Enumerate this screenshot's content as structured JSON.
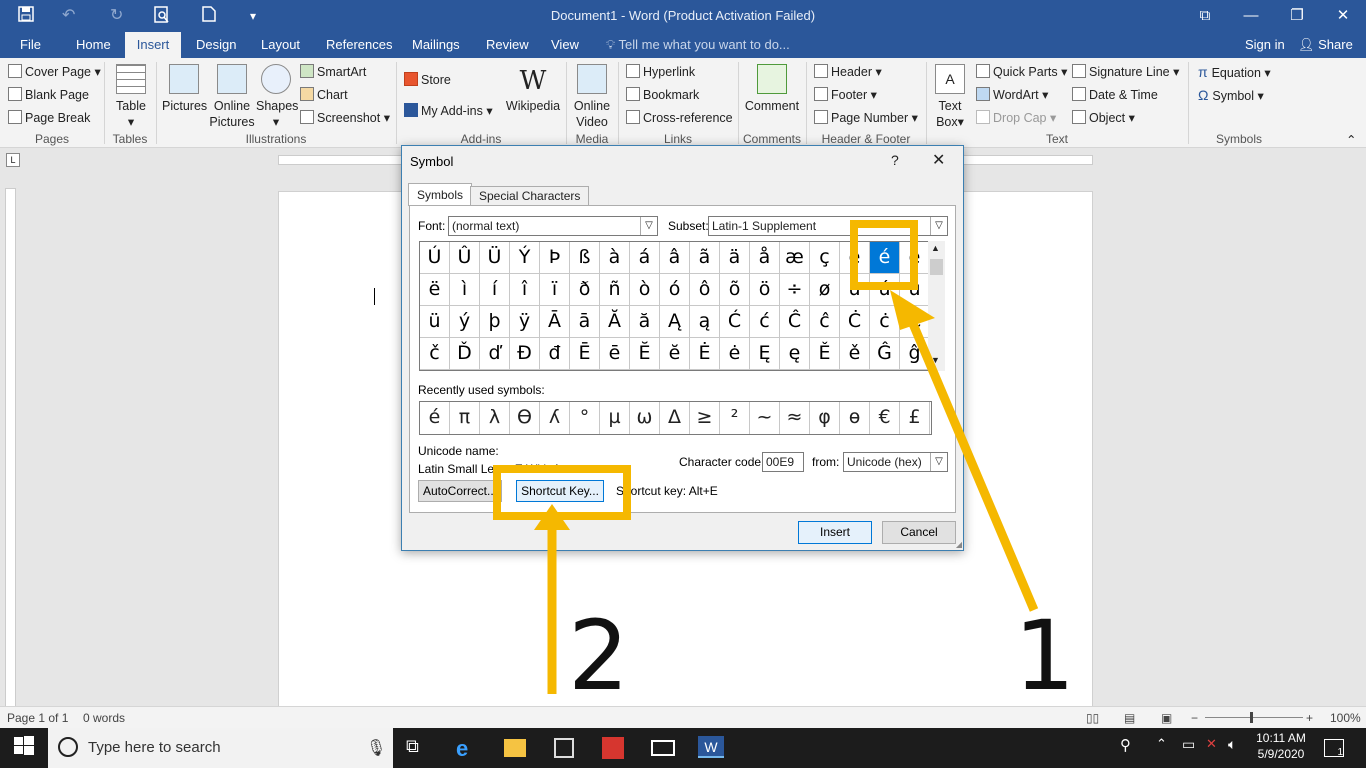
{
  "window": {
    "title": "Document1 - Word (Product Activation Failed)"
  },
  "tabs": [
    {
      "label": "File"
    },
    {
      "label": "Home"
    },
    {
      "label": "Insert"
    },
    {
      "label": "Design"
    },
    {
      "label": "Layout"
    },
    {
      "label": "References"
    },
    {
      "label": "Mailings"
    },
    {
      "label": "Review"
    },
    {
      "label": "View"
    }
  ],
  "tellme": "Tell me what you want to do...",
  "account": {
    "signin": "Sign in",
    "share": "Share"
  },
  "ribbon": {
    "pages": {
      "cover": "Cover Page",
      "blank": "Blank Page",
      "break": "Page Break",
      "group": "Pages"
    },
    "tables": {
      "table": "Table",
      "group": "Tables"
    },
    "illustrations": {
      "pictures": "Pictures",
      "online": "Online",
      "online2": "Pictures",
      "shapes": "Shapes",
      "smartart": "SmartArt",
      "chart": "Chart",
      "screenshot": "Screenshot",
      "group": "Illustrations"
    },
    "addins": {
      "store": "Store",
      "myaddins": "My Add-ins",
      "wikipedia": "Wikipedia",
      "group": "Add-ins"
    },
    "media": {
      "online": "Online",
      "video": "Video",
      "group": "Media"
    },
    "links": {
      "hyperlink": "Hyperlink",
      "bookmark": "Bookmark",
      "crossref": "Cross-reference",
      "group": "Links"
    },
    "comments": {
      "comment": "Comment",
      "group": "Comments"
    },
    "headerfooter": {
      "header": "Header",
      "footer": "Footer",
      "pagenumber": "Page Number",
      "group": "Header & Footer"
    },
    "text": {
      "textbox": "Text",
      "textbox2": "Box",
      "quickparts": "Quick Parts",
      "wordart": "WordArt",
      "dropcap": "Drop Cap",
      "sigline": "Signature Line",
      "datetime": "Date & Time",
      "object": "Object",
      "group": "Text"
    },
    "symbols": {
      "equation": "Equation",
      "symbol": "Symbol",
      "group": "Symbols"
    }
  },
  "dialog": {
    "title": "Symbol",
    "help": "?",
    "tab_symbols": "Symbols",
    "tab_special": "Special Characters",
    "font_label": "Font:",
    "font_value": "(normal text)",
    "subset_label": "Subset:",
    "subset_value": "Latin-1 Supplement",
    "grid": [
      [
        "Ú",
        "Û",
        "Ü",
        "Ý",
        "Þ",
        "ß",
        "à",
        "á",
        "â",
        "ã",
        "ä",
        "å",
        "æ",
        "ç",
        "è",
        "é",
        "ê"
      ],
      [
        "ë",
        "ì",
        "í",
        "î",
        "ï",
        "ð",
        "ñ",
        "ò",
        "ó",
        "ô",
        "õ",
        "ö",
        "÷",
        "ø",
        "ù",
        "ú",
        "û"
      ],
      [
        "ü",
        "ý",
        "þ",
        "ÿ",
        "Ā",
        "ā",
        "Ă",
        "ă",
        "Ą",
        "ą",
        "Ć",
        "ć",
        "Ĉ",
        "ĉ",
        "Ċ",
        "ċ",
        "Č"
      ],
      [
        "č",
        "Ď",
        "ď",
        "Đ",
        "đ",
        "Ē",
        "ē",
        "Ĕ",
        "ĕ",
        "Ė",
        "ė",
        "Ę",
        "ę",
        "Ě",
        "ě",
        "Ĝ",
        "ĝ"
      ]
    ],
    "recent_label": "Recently used symbols:",
    "recent": [
      "é",
      "π",
      "λ",
      "ϴ",
      "ʎ",
      "°",
      "µ",
      "ω",
      "Δ",
      "≥",
      "²",
      "~",
      "≈",
      "φ",
      "ө",
      "€",
      "£"
    ],
    "unicode_name_label": "Unicode name:",
    "unicode_name_value": "Latin Small Letter E With Acute",
    "charcode_label": "Character code:",
    "charcode_value": "00E9",
    "from_label": "from:",
    "from_value": "Unicode (hex)",
    "autocorrect": "AutoCorrect...",
    "shortcutkey": "Shortcut Key...",
    "shortcut_text": "Shortcut key: Alt+E",
    "insert": "Insert",
    "cancel": "Cancel"
  },
  "status": {
    "page": "Page 1 of 1",
    "words": "0 words",
    "zoom": "100%"
  },
  "taskbar": {
    "search": "Type here to search",
    "time": "10:11 AM",
    "date": "5/9/2020",
    "notif": "1"
  },
  "annotations": {
    "one": "1",
    "two": "2",
    "color": "#f5b800"
  }
}
